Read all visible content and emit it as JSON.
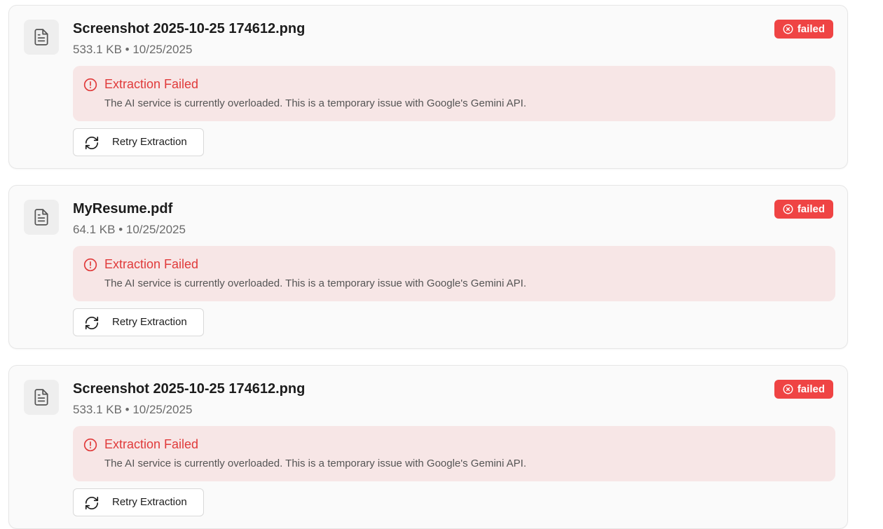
{
  "colors": {
    "badge_bg": "#ef4444",
    "error_bg": "#f7e6e6",
    "error_text": "#e03a3a",
    "card_bg": "#fafafa"
  },
  "icons": {
    "file": "file-text-icon",
    "badge": "x-circle-icon",
    "error": "alert-circle-icon",
    "retry": "refresh-icon"
  },
  "files": [
    {
      "name": "Screenshot 2025-10-25 174612.png",
      "meta": "533.1 KB • 10/25/2025",
      "status": "failed",
      "error_title": "Extraction Failed",
      "error_message": "The AI service is currently overloaded. This is a temporary issue with Google's Gemini API.",
      "retry_label": "Retry Extraction"
    },
    {
      "name": "MyResume.pdf",
      "meta": "64.1 KB • 10/25/2025",
      "status": "failed",
      "error_title": "Extraction Failed",
      "error_message": "The AI service is currently overloaded. This is a temporary issue with Google's Gemini API.",
      "retry_label": "Retry Extraction"
    },
    {
      "name": "Screenshot 2025-10-25 174612.png",
      "meta": "533.1 KB • 10/25/2025",
      "status": "failed",
      "error_title": "Extraction Failed",
      "error_message": "The AI service is currently overloaded. This is a temporary issue with Google's Gemini API.",
      "retry_label": "Retry Extraction"
    }
  ]
}
